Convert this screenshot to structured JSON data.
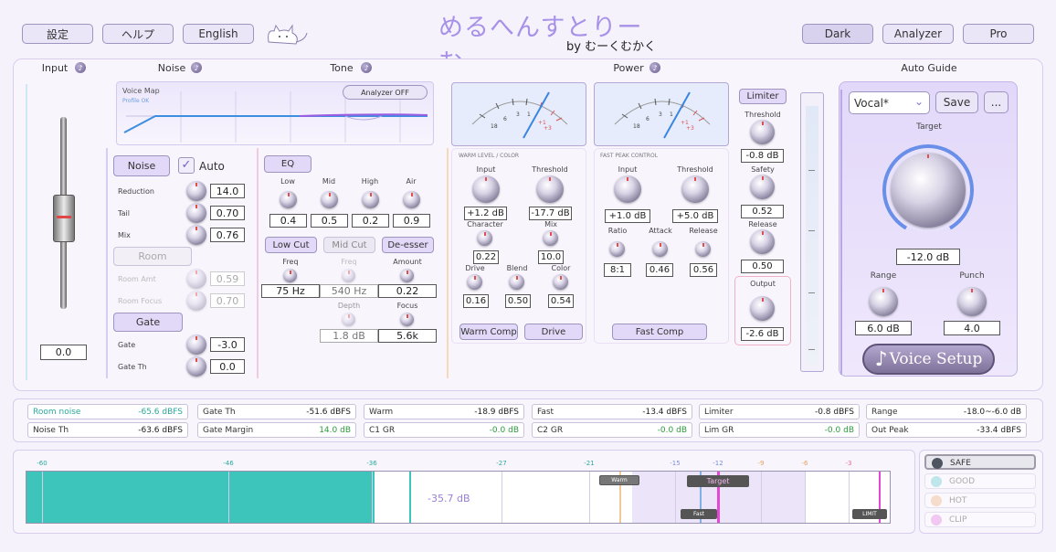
{
  "header": {
    "settings": "設定",
    "help": "ヘルプ",
    "language": "English",
    "logo_title": "めるへんすとりーむ",
    "logo_byline": "by むーくむかく",
    "dark": "Dark",
    "analyzer": "Analyzer",
    "pro": "Pro"
  },
  "sections": {
    "input": "Input",
    "noise": "Noise",
    "tone": "Tone",
    "power": "Power",
    "auto_guide": "Auto Guide"
  },
  "input": {
    "value": "0.0"
  },
  "voicemap": {
    "title": "Voice Map",
    "status": "Profile OK",
    "analyzer_btn": "Analyzer OFF"
  },
  "noise": {
    "button": "Noise",
    "auto": "Auto",
    "reduction_label": "Reduction",
    "reduction": "14.0",
    "tail_label": "Tail",
    "tail": "0.70",
    "mix_label": "Mix",
    "mix": "0.76",
    "room_button": "Room",
    "room_amt_label": "Room Amt",
    "room_amt": "0.59",
    "room_focus_label": "Room Focus",
    "room_focus": "0.70",
    "gate_button": "Gate",
    "gate_label": "Gate",
    "gate": "-3.0",
    "gate_th_label": "Gate Th",
    "gate_th": "0.0"
  },
  "eq": {
    "button": "EQ",
    "bands": [
      {
        "label": "Low",
        "value": "0.4"
      },
      {
        "label": "Mid",
        "value": "0.5"
      },
      {
        "label": "High",
        "value": "0.2"
      },
      {
        "label": "Air",
        "value": "0.9"
      }
    ],
    "lowcut": "Low Cut",
    "midcut": "Mid Cut",
    "deesser": "De-esser",
    "freq1_label": "Freq",
    "freq1": "75 Hz",
    "freq2_label": "Freq",
    "freq2": "540 Hz",
    "amount_label": "Amount",
    "amount": "0.22",
    "depth_label": "Depth",
    "depth": "1.8 dB",
    "focus_label": "Focus",
    "focus": "5.6k"
  },
  "warm": {
    "title": "WARM LEVEL / COLOR",
    "input_label": "Input",
    "input": "+1.2 dB",
    "threshold_label": "Threshold",
    "threshold": "-17.7 dB",
    "character_label": "Character",
    "character": "0.22",
    "mix_label": "Mix",
    "mix": "10.0",
    "drive_label": "Drive",
    "drive": "0.16",
    "blend_label": "Blend",
    "blend": "0.50",
    "color_label": "Color",
    "color": "0.54",
    "warm_comp": "Warm Comp",
    "drive_btn": "Drive"
  },
  "fast": {
    "title": "FAST PEAK CONTROL",
    "input_label": "Input",
    "input": "+1.0 dB",
    "threshold_label": "Threshold",
    "threshold": "+5.0 dB",
    "ratio_label": "Ratio",
    "ratio": "8:1",
    "attack_label": "Attack",
    "attack": "0.46",
    "release_label": "Release",
    "release": "0.56",
    "fast_comp": "Fast Comp"
  },
  "limiter": {
    "button": "Limiter",
    "threshold_label": "Threshold",
    "threshold": "-0.8 dB",
    "safety_label": "Safety",
    "safety": "0.52",
    "release_label": "Release",
    "release": "0.50",
    "output_label": "Output",
    "output": "-2.6 dB"
  },
  "vu_scale": {
    "a": "18",
    "b": "6",
    "c": "3",
    "d": "1",
    "e": "+1",
    "f": "+3"
  },
  "auto": {
    "preset": "Vocal*",
    "save": "Save",
    "more": "...",
    "target_label": "Target",
    "target": "-12.0 dB",
    "range_label": "Range",
    "range": "6.0 dB",
    "punch_label": "Punch",
    "punch": "4.0",
    "voice_setup": "Voice Setup"
  },
  "stats": [
    [
      {
        "k": "Room noise",
        "v": "-65.6 dBFS",
        "kc": "#2aa89a",
        "vc": "#2aa89a"
      },
      {
        "k": "Gate Th",
        "v": "-51.6 dBFS"
      },
      {
        "k": "Warm",
        "v": "-18.9 dBFS"
      },
      {
        "k": "Fast",
        "v": "-13.4 dBFS"
      },
      {
        "k": "Limiter",
        "v": "-0.8 dBFS"
      },
      {
        "k": "Range",
        "v": "-18.0~-6.0 dB"
      }
    ],
    [
      {
        "k": "Noise Th",
        "v": "-63.6 dBFS"
      },
      {
        "k": "Gate Margin",
        "v": "14.0 dB",
        "vc": "#2e9c3e"
      },
      {
        "k": "C1 GR",
        "v": "-0.0 dB",
        "vc": "#2e9c3e"
      },
      {
        "k": "C2 GR",
        "v": "-0.0 dB",
        "vc": "#2e9c3e"
      },
      {
        "k": "Lim GR",
        "v": "-0.0 dB",
        "vc": "#2e9c3e"
      },
      {
        "k": "Out Peak",
        "v": "-33.4 dBFS"
      }
    ]
  ],
  "meter": {
    "ticks": [
      "-60",
      "-46",
      "-36",
      "-27",
      "-21",
      "-15",
      "-12",
      "-9",
      "-6",
      "-3"
    ],
    "level": "-35.7 dB",
    "warm": "Warm",
    "target": "Target",
    "fast": "Fast",
    "limit": "LIMIT"
  },
  "legend": [
    {
      "label": "SAFE",
      "color": "#4c5560"
    },
    {
      "label": "GOOD",
      "color": "#bfe6ea"
    },
    {
      "label": "HOT",
      "color": "#f5dccb"
    },
    {
      "label": "CLIP",
      "color": "#f2c7f2"
    }
  ],
  "colors": {
    "accent": "#b6a6e8",
    "meter_fill": "#3dc4bb",
    "target": "#e646d4"
  }
}
